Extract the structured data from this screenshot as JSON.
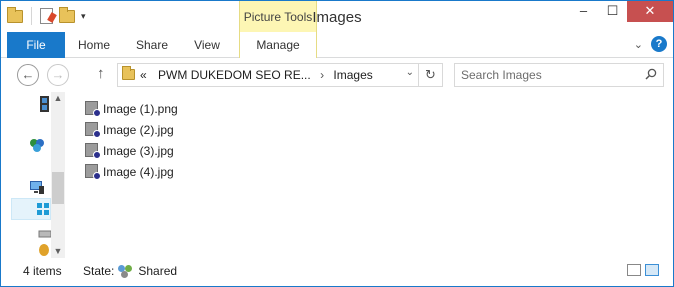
{
  "window": {
    "title": "Images",
    "context_tab_group": "Picture Tools",
    "caption": {
      "minimize": "–",
      "maximize": "☐",
      "close": "✕"
    }
  },
  "quick_access": {
    "dropdown_glyph": "▾"
  },
  "ribbon": {
    "tabs": [
      {
        "label": "File"
      },
      {
        "label": "Home"
      },
      {
        "label": "Share"
      },
      {
        "label": "View"
      },
      {
        "label": "Manage"
      }
    ],
    "expand_glyph": "⌄",
    "help_glyph": "?"
  },
  "nav": {
    "back_glyph": "←",
    "forward_glyph": "→",
    "up_glyph": "↑",
    "address": {
      "overflow": "«",
      "segments": [
        "PWM DUKEDOM SEO RE...",
        "Images"
      ],
      "separator": "›",
      "dropdown_glyph": "⌄",
      "refresh_glyph": "↻"
    },
    "search": {
      "placeholder": "Search Images"
    }
  },
  "files": [
    {
      "name": "Image (1).png"
    },
    {
      "name": "Image (2).jpg"
    },
    {
      "name": "Image (3).jpg"
    },
    {
      "name": "Image (4).jpg"
    }
  ],
  "status": {
    "item_count": "4 items",
    "state_label": "State:",
    "state_value": "Shared"
  },
  "colors": {
    "accent": "#1979ca",
    "context_tab": "#fdf6b4",
    "close_button": "#c75050"
  }
}
